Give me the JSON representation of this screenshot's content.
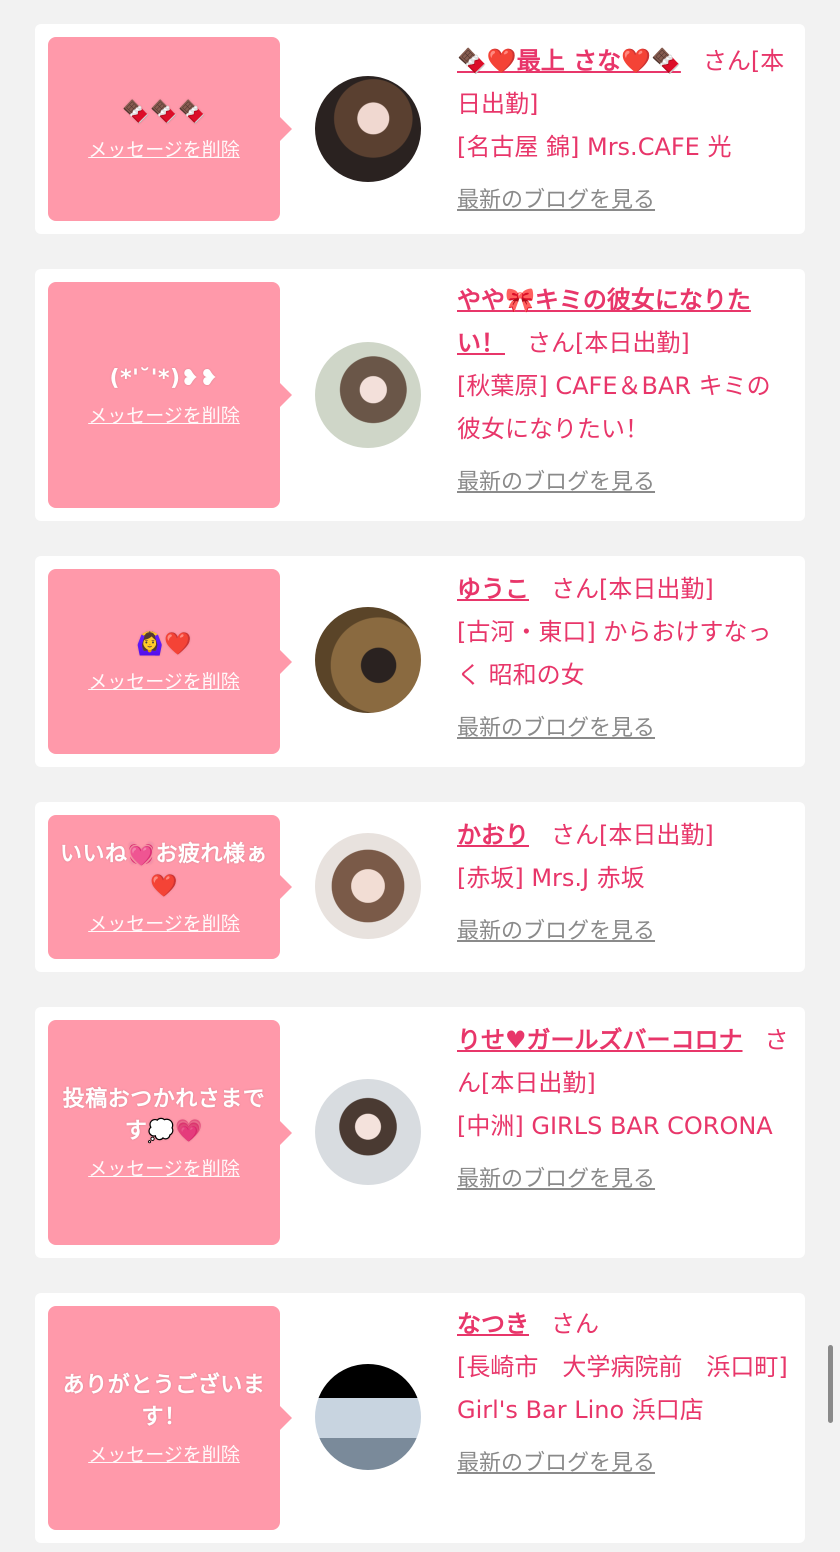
{
  "accent_color": "#e8366a",
  "bubble_color": "#ff99aa",
  "cards": [
    {
      "message": "🍫🍫🍫",
      "delete_label": "メッセージを削除",
      "name": "🍫❤️最上 さな❤️🍫",
      "san": "さん",
      "status": "[本日出勤]",
      "shop": "[名古屋 錦] Mrs.CAFE 光",
      "blog_label": "最新のブログを見る"
    },
    {
      "message": "(*'˘'*)❥❥",
      "delete_label": "メッセージを削除",
      "name": "やや🎀キミの彼女になりたい！",
      "san": "さん",
      "status": "[本日出勤]",
      "shop": "[秋葉原] CAFE＆BAR キミの彼女になりたい！",
      "blog_label": "最新のブログを見る"
    },
    {
      "message": "🙆‍♀️❤️",
      "delete_label": "メッセージを削除",
      "name": "ゆうこ",
      "san": "さん",
      "status": "[本日出勤]",
      "shop": "[古河・東口] からおけすなっく 昭和の女",
      "blog_label": "最新のブログを見る"
    },
    {
      "message": "いいね💓お疲れ様ぁ❤️",
      "delete_label": "メッセージを削除",
      "name": "かおり",
      "san": "さん",
      "status": "[本日出勤]",
      "shop": "[赤坂] Mrs.J 赤坂",
      "blog_label": "最新のブログを見る"
    },
    {
      "message": "投稿おつかれさまです💭💗",
      "delete_label": "メッセージを削除",
      "name": "りせ♥ガールズバーコロナ",
      "san": "さん",
      "status": "[本日出勤]",
      "shop": "[中洲] GIRLS BAR CORONA",
      "blog_label": "最新のブログを見る"
    },
    {
      "message": "ありがとうございます！",
      "delete_label": "メッセージを削除",
      "name": "なつき",
      "san": "さん",
      "status": "",
      "shop": "[長崎市　大学病院前　浜口町] Girl's Bar Lino 浜口店",
      "blog_label": "最新のブログを見る"
    }
  ]
}
